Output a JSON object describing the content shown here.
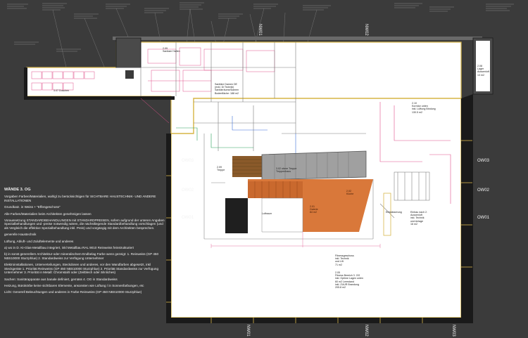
{
  "notes": {
    "title": "WÄNDE 3. OG",
    "para1": "Vorgaben Farben/Materialien, wahlgl zu berücksichtigen für SICHTBARE HAUSTECHNIK- UND ANDERE INSTALLATIONEN",
    "para2": "Grundkatz. in Weiss + \"Effengeschoss\"",
    "para3": "Alle Farben/Materialien beim Architekten genehmigen lassen",
    "para4": "Voraussetzung STANDARDBEHANDLUNGEN mit STANDARDPREISEN, sofern aufgrund der unteren Angaben Spezialbehandlungen und -preise notwendig wären, die nächstliegende Standardbehandlung vorschlagen (und als Vergleich die effektive Spezialbehandlung inkl. Preis) und vorgängig mit dem Architekten besprechen.",
    "para5": "generelle Haustechnik",
    "para6": "Lüftung, Abluft- und Zuluftelemente und anderes",
    "para7": "a) wo in D. KI-Glas-Metallbau integriert, inkl Metallbau RAL 9010 Reinweiss feinstrukturiert",
    "para8": "b) in sonst generellem Architektur-oder mineralischem Endbelag Farbe wenn gezeigt: 1. Reinweiss (GP 450 NBS10000 Sturzphlue) 2. Standardweiss zur Verfügung Unternehmer",
    "para9": "Elektroinstallationen, Unterverteilungen, Steckdosen und anderes, vor den Wandfarben abgesetzt, inkl Steckgeräte 1. Priorität Reinweiss (GP 450 NBS10000 Sturzphlue) 2. Priorität Standardweiss zur Verfügung Unternehmer 3. Priorität in Metall: Chromstahl oder (Zeitblech oder ähnliches)",
    "para10": "Sachen: Sanitärapparate aus banale definiert, gemäss 4. OG in Standardweiss",
    "para11": "Heizung, Bürokörbe keine sichtbaren Elemente, ansonsten wie Lüftung / in Sonnenfarbungen, etc",
    "para12": "Licht: Generell Beleuchtungen und anderes in Farbe Reinweiss (GP 450 NBS10000 Sturzphlue)"
  },
  "wall_labels": {
    "ow03_left": "OW03",
    "ow02_left": "OW02",
    "ow01_left": "OW01",
    "ow03_right": "OW03",
    "ow02_right": "OW02",
    "ow01_right": "OW01",
    "nw01_top": "NW01",
    "nw02_top": "NW02",
    "nw01_bottom": "NW01",
    "nw02_bottom": "NW02",
    "nw03_bottom": "NW03"
  },
  "rooms": {
    "dusche": "3.07 Duschen",
    "sanitaer": "2.09\nSanitaer Hallen",
    "bad_wc": "Sanitäre Damen DE\n(exkl. Di Technik)\nSanitärräume/Damen\nBodenfläche: 188 m2",
    "korridor": "2.10\nKorridor unten\ninkl. Lüftung Bindung\n130.5 m2",
    "lager": "2.08\nLager\nAussenluft\n13 m2",
    "luftraum": "Luftraum",
    "treppe": "2.09\nTreppe",
    "treppe_oben": "3.02 obere Treppe\nTreppenhaus",
    "galerie": "2.01\nGalerie\n84 m2",
    "kuche": "2.02\nKüche",
    "entwaesserung": "Entwässerung",
    "einbau": "Einbau nach 2.\nAussenluft\ninkl. Technik\nund Anlage\n16 m2",
    "fitness": "Fitnessgeschoss\ninkl. Technik\nund Lift\n71 m2",
    "foyer": "2.05\nFitness Bereich 3. OG\ninkl. Optime Lagen unten\n60 m2 Leerstand\ninkl. ZUUR Brandung\n205.8 m2"
  }
}
